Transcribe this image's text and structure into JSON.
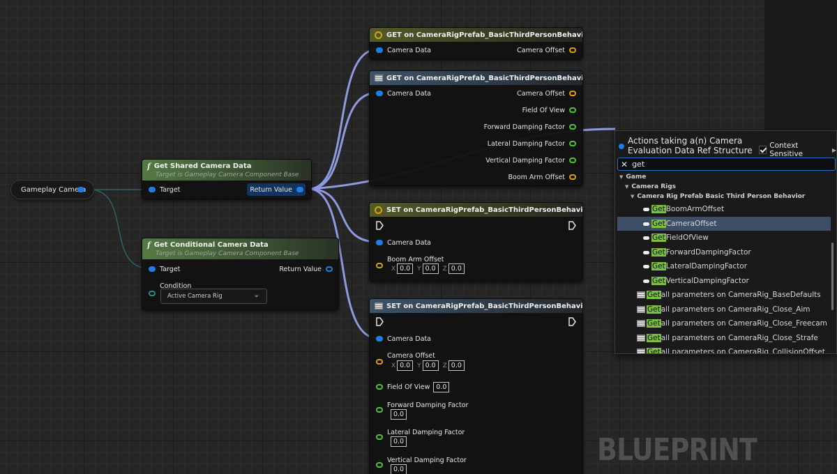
{
  "canvas": {
    "watermark": "BLUEPRINT"
  },
  "gameplay_camera_node": {
    "label": "Gameplay Camera"
  },
  "get_shared_node": {
    "title": "Get Shared Camera Data",
    "subtitle": "Target is Gameplay Camera Component Base",
    "target_label": "Target",
    "return_label": "Return Value"
  },
  "get_conditional_node": {
    "title": "Get Conditional Camera Data",
    "subtitle": "Target is Gameplay Camera Component Base",
    "target_label": "Target",
    "return_label": "Return Value",
    "condition_label": "Condition",
    "condition_value": "Active Camera Rig"
  },
  "get_node_1": {
    "title": "GET on CameraRigPrefab_BasicThirdPersonBehavior",
    "input": "Camera Data",
    "outputs": [
      "Camera Offset"
    ]
  },
  "get_node_2": {
    "title": "GET on CameraRigPrefab_BasicThirdPersonBehavior",
    "input": "Camera Data",
    "outputs": [
      "Camera Offset",
      "Field Of View",
      "Forward Damping Factor",
      "Lateral Damping Factor",
      "Vertical Damping Factor",
      "Boom Arm Offset"
    ]
  },
  "set_node_1": {
    "title": "SET on CameraRigPrefab_BasicThirdPersonBehavior",
    "camera_data": "Camera Data",
    "boom_label": "Boom Arm Offset",
    "boom_x": "0.0",
    "boom_y": "0.0",
    "boom_z": "0.0",
    "axis_x": "X",
    "axis_y": "Y",
    "axis_z": "Z"
  },
  "set_node_2": {
    "title": "SET on CameraRigPrefab_BasicThirdPersonBehavior",
    "camera_data": "Camera Data",
    "offset_label": "Camera Offset",
    "offset_x": "0.0",
    "offset_y": "0.0",
    "offset_z": "0.0",
    "axis_x": "X",
    "axis_y": "Y",
    "axis_z": "Z",
    "fov_label": "Field Of View",
    "fov_value": "0.0",
    "forward_label": "Forward Damping Factor",
    "forward_value": "0.0",
    "lateral_label": "Lateral Damping Factor",
    "lateral_value": "0.0",
    "vertical_label": "Vertical Damping Factor",
    "vertical_value": "0.0"
  },
  "action_menu": {
    "title_line1": "Actions taking a(n) Camera",
    "title_line2": "Evaluation Data Ref Structure",
    "context_sensitive": "Context Sensitive",
    "search_value": "get",
    "cat_game": "Game",
    "cat_camera_rigs": "Camera Rigs",
    "cat_prefab": "Camera Rig Prefab Basic Third Person Behavior",
    "get_prefix": "Get",
    "items": [
      {
        "rest": "BoomArmOffset"
      },
      {
        "rest": "CameraOffset"
      },
      {
        "rest": "FieldOfView"
      },
      {
        "rest": "ForwardDampingFactor"
      },
      {
        "rest": "LateralDampingFactor"
      },
      {
        "rest": "VerticalDampingFactor"
      }
    ],
    "all_items": [
      {
        "rest": " all parameters on CameraRig_BaseDefaults"
      },
      {
        "rest": " all parameters on CameraRig_Close_Aim"
      },
      {
        "rest": " all parameters on CameraRig_Close_Freecam"
      },
      {
        "rest": " all parameters on CameraRig_Close_Strafe"
      },
      {
        "rest": " all parameters on CameraRig_CollisionOffset"
      }
    ]
  },
  "colors": {
    "wire": "#8f9be0",
    "pin_blue": "#1e7de6",
    "pin_yellow": "#d8a415",
    "pin_green": "#51c23a",
    "search_highlight": "#7bc043",
    "selected_row": "#3d4e66"
  }
}
